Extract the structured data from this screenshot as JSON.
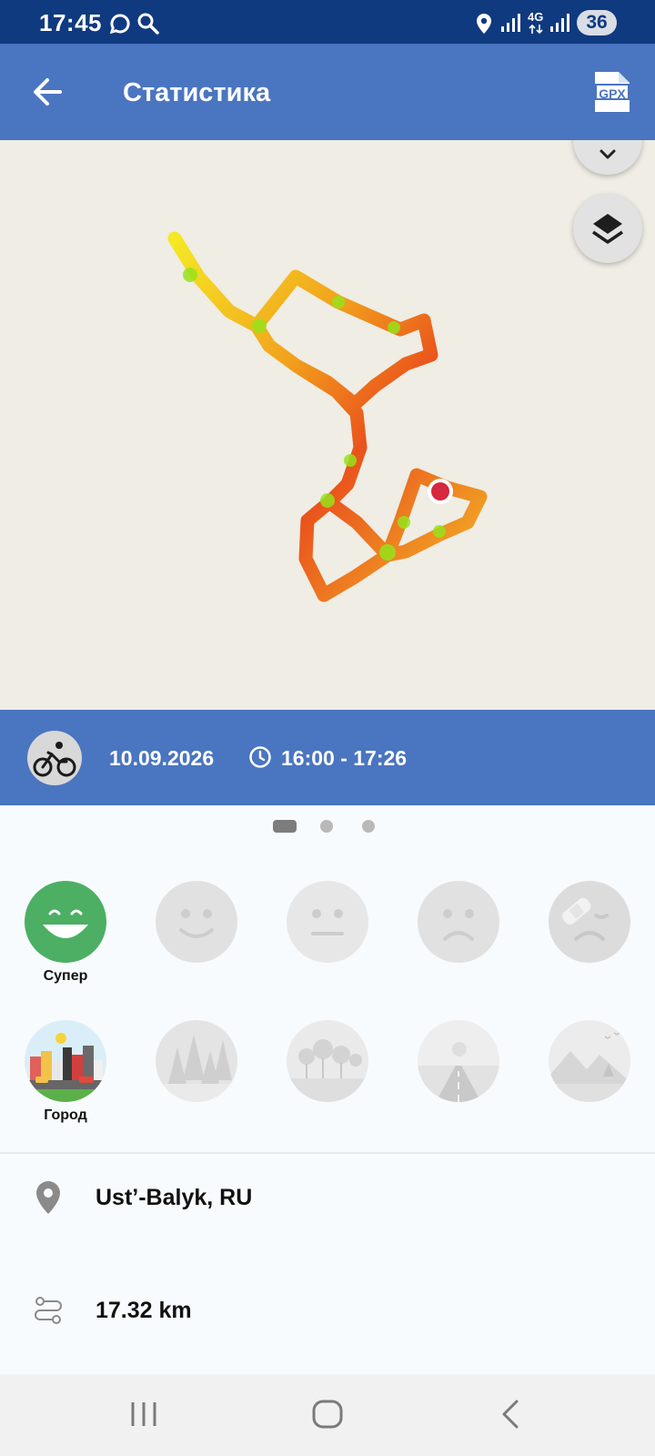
{
  "status_bar": {
    "time": "17:45",
    "battery": "36",
    "network": "4G"
  },
  "app_bar": {
    "title": "Статистика",
    "gpx_label": "GPX"
  },
  "colors": {
    "status_bar": "#0f3a80",
    "app_bar": "#4a75c0",
    "mood_selected": "#4caf63",
    "map_bg": "#efede4"
  },
  "trip": {
    "date": "10.09.2026",
    "time_range": "16:00 - 17:26"
  },
  "moods": [
    {
      "id": "great",
      "label": "Супер",
      "selected": true
    },
    {
      "id": "good",
      "label": "",
      "selected": false
    },
    {
      "id": "neutral",
      "label": "",
      "selected": false
    },
    {
      "id": "sad",
      "label": "",
      "selected": false
    },
    {
      "id": "injured",
      "label": "",
      "selected": false
    }
  ],
  "terrains": [
    {
      "id": "city",
      "label": "Город",
      "selected": true
    },
    {
      "id": "forest",
      "label": "",
      "selected": false
    },
    {
      "id": "park",
      "label": "",
      "selected": false
    },
    {
      "id": "road",
      "label": "",
      "selected": false
    },
    {
      "id": "mountains",
      "label": "",
      "selected": false
    }
  ],
  "details": {
    "location": "Ust’-Balyk, RU",
    "distance": "17.32 km"
  },
  "pager": {
    "count": 3,
    "active": 0
  }
}
